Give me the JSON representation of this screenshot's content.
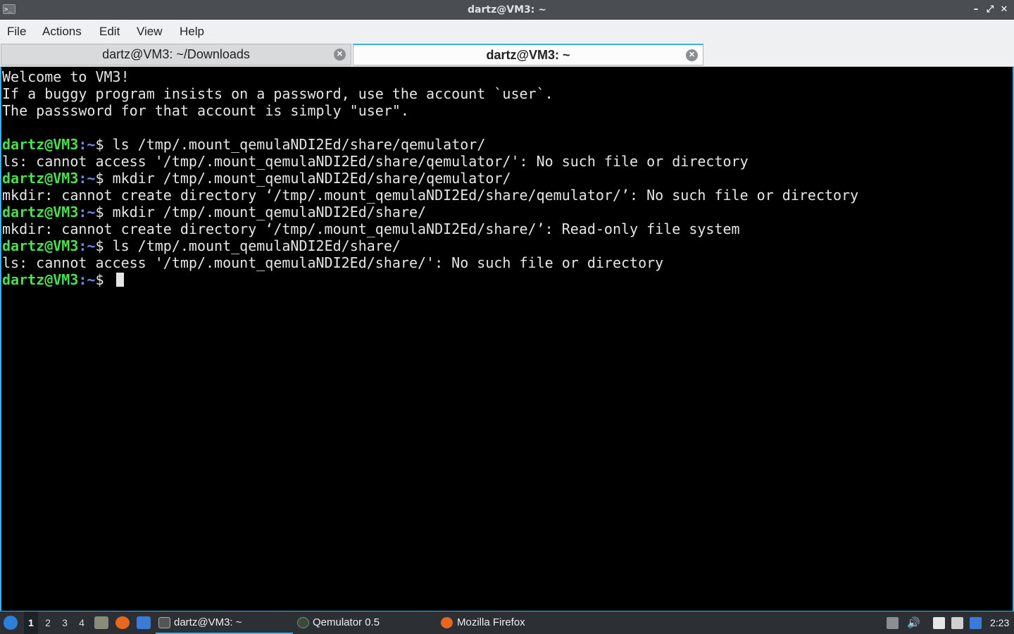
{
  "window": {
    "title": "dartz@VM3: ~",
    "controls": {
      "minimize": "–",
      "restore": "⤢",
      "close": "✕"
    }
  },
  "menu": [
    "File",
    "Actions",
    "Edit",
    "View",
    "Help"
  ],
  "tabs": [
    {
      "label": "dartz@VM3: ~/Downloads",
      "active": false
    },
    {
      "label": "dartz@VM3: ~",
      "active": true
    }
  ],
  "terminal": {
    "welcome": [
      "Welcome to VM3!",
      "If a buggy program insists on a password, use the account `user`.",
      "The passsword for that account is simply \"user\"."
    ],
    "prompt_user": "dartz@VM3",
    "prompt_path": ":~",
    "prompt_symbol": "$ ",
    "entries": [
      {
        "command": "ls /tmp/.mount_qemulaNDI2Ed/share/qemulator/",
        "output": "ls: cannot access '/tmp/.mount_qemulaNDI2Ed/share/qemulator/': No such file or directory"
      },
      {
        "command": "mkdir /tmp/.mount_qemulaNDI2Ed/share/qemulator/",
        "output": "mkdir: cannot create directory ‘/tmp/.mount_qemulaNDI2Ed/share/qemulator/’: No such file or directory"
      },
      {
        "command": "mkdir /tmp/.mount_qemulaNDI2Ed/share/",
        "output": "mkdir: cannot create directory ‘/tmp/.mount_qemulaNDI2Ed/share/’: Read-only file system"
      },
      {
        "command": "ls /tmp/.mount_qemulaNDI2Ed/share/",
        "output": "ls: cannot access '/tmp/.mount_qemulaNDI2Ed/share/': No such file or directory"
      }
    ]
  },
  "taskbar": {
    "desktops": [
      "1",
      "2",
      "3",
      "4"
    ],
    "tasks": [
      {
        "label": "dartz@VM3: ~",
        "icon": "terminal-icon",
        "active": true
      },
      {
        "label": "Qemulator 0.5",
        "icon": "qemulator-icon",
        "active": false
      },
      {
        "label": "Mozilla Firefox",
        "icon": "firefox-icon",
        "active": false
      }
    ],
    "clock": "2:23"
  },
  "colors": {
    "accent": "#3daee9",
    "prompt_user": "#4edd4e",
    "prompt_path": "#6c8ef0"
  }
}
